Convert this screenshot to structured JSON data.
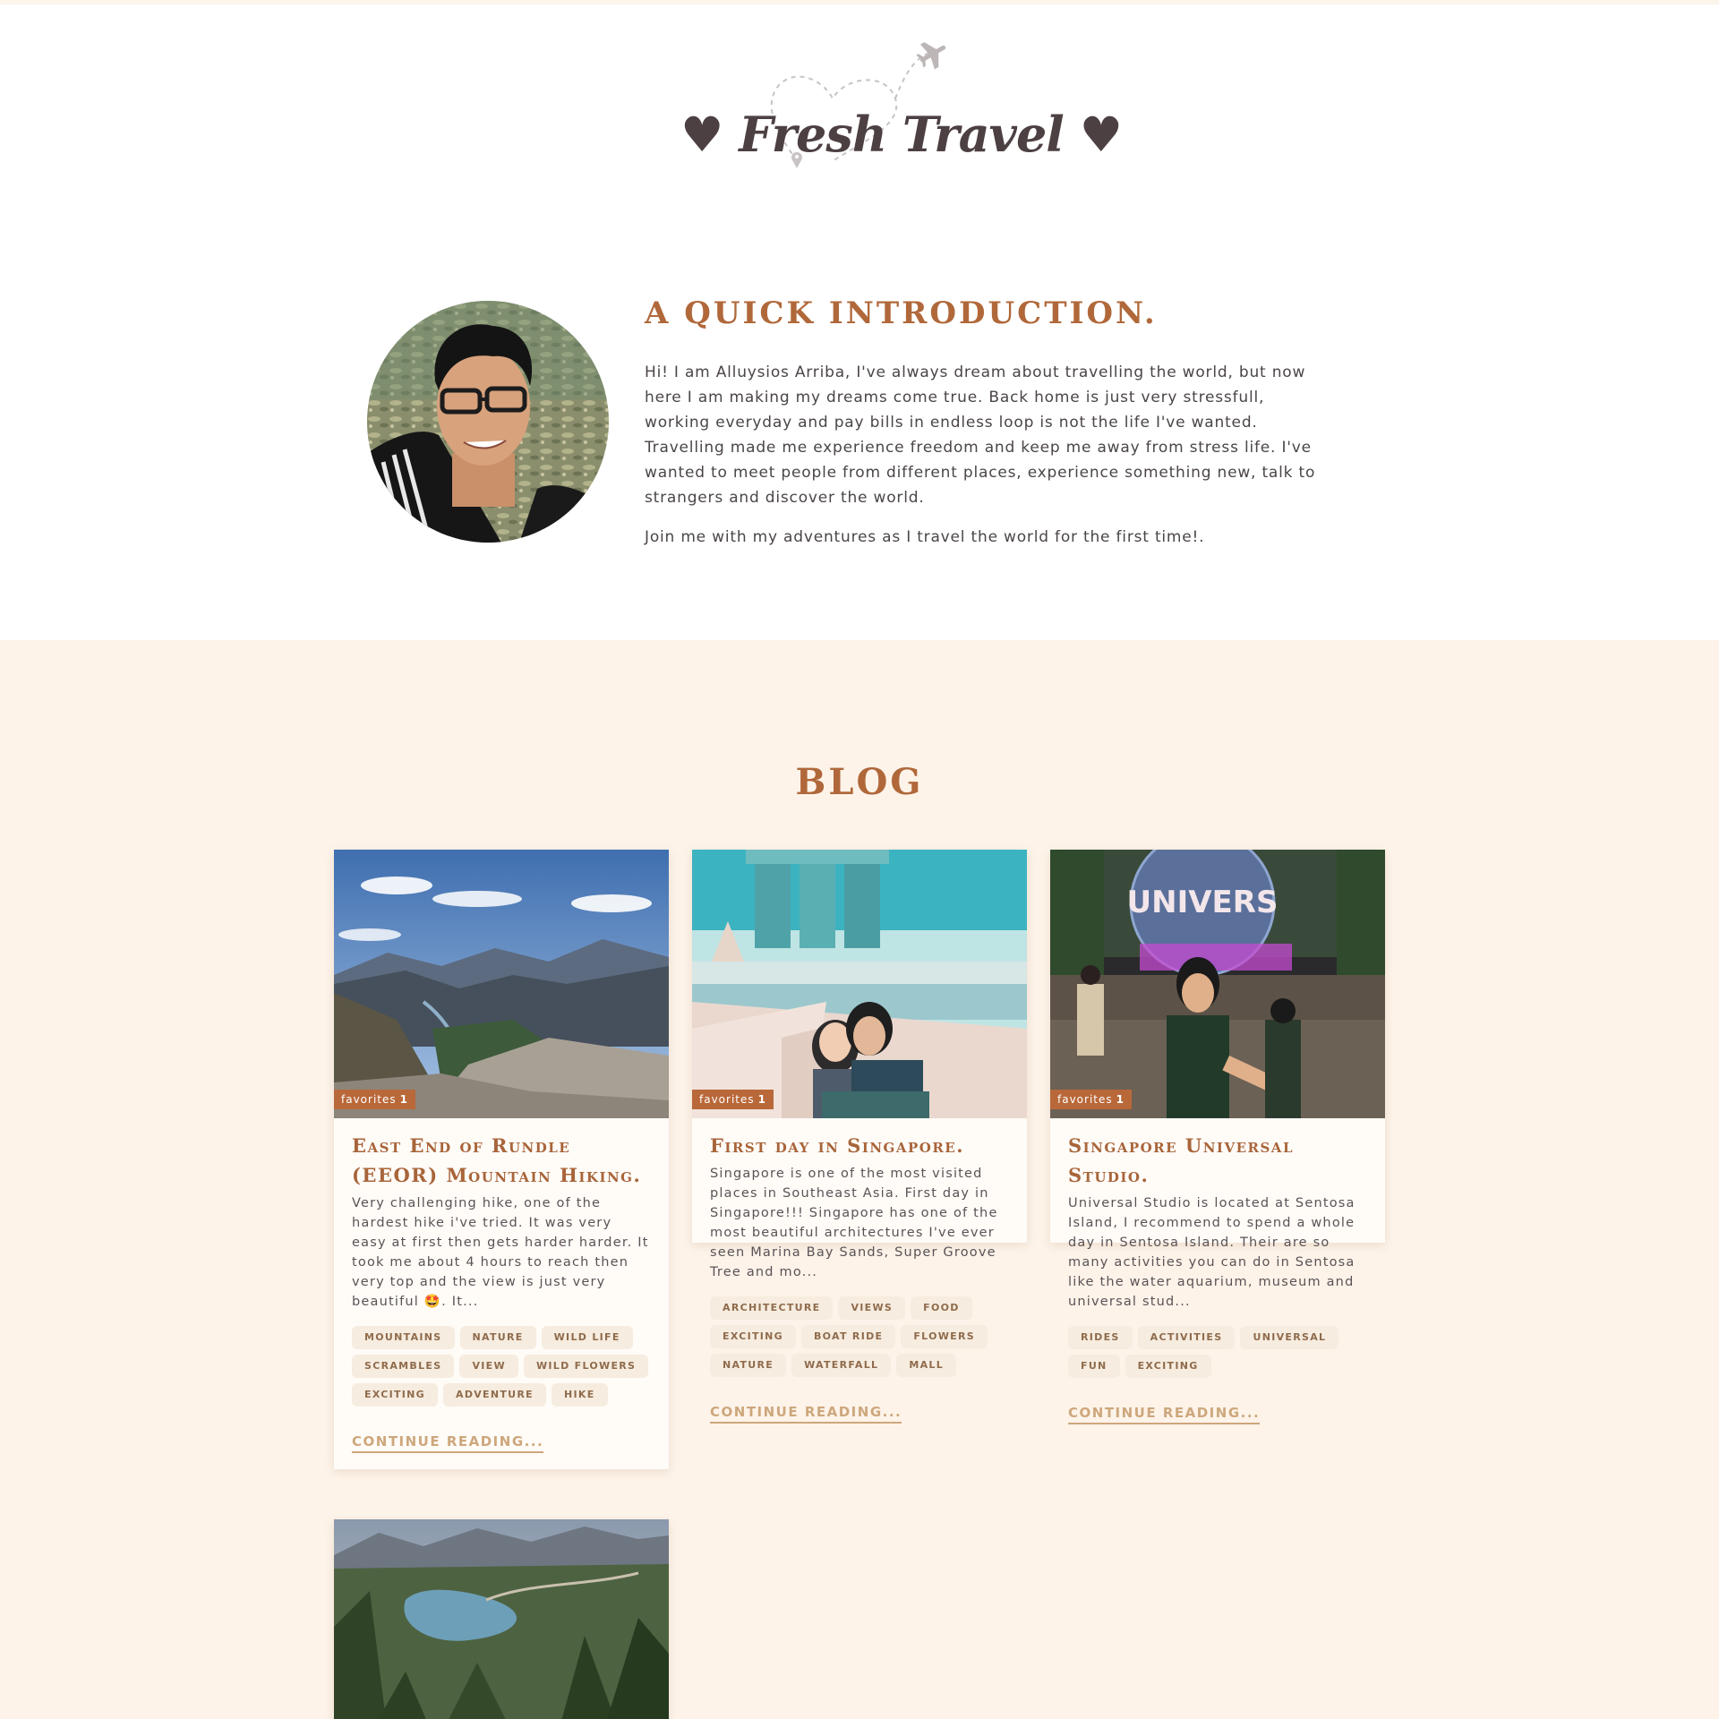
{
  "site": {
    "logo_text": "♥ Fresh Travel ♥"
  },
  "intro": {
    "title": "A QUICK INTRODUCTION.",
    "paragraphs": [
      "Hi! I am Alluysios Arriba, I've always dream about travelling the world, but now here I am making my dreams come true. Back home is just very stressfull, working everyday and pay bills in endless loop is not the life I've wanted. Travelling made me experience freedom and keep me away from stress life. I've wanted to meet people from different places, experience something new, talk to strangers and discover the world.",
      "Join me with my adventures as I travel the world for the first time!."
    ]
  },
  "blog": {
    "heading": "BLOG",
    "posts": [
      {
        "badge_label": "favorites",
        "badge_count": "1",
        "title": "East End of Rundle (EEOR) Mountain Hiking.",
        "excerpt": "Very challenging hike, one of the hardest hike i've tried. It was very easy at first then gets harder harder. It took me about 4 hours to reach then very top and the view is just very beautiful 🤩. It...",
        "tags": [
          "Mountains",
          "Nature",
          "Wild Life",
          "Scrambles",
          "View",
          "Wild Flowers",
          "Exciting",
          "Adventure",
          "Hike"
        ],
        "continue_label": "Continue reading..."
      },
      {
        "badge_label": "favorites",
        "badge_count": "1",
        "title": "First day in Singapore.",
        "excerpt": "Singapore is one of the most visited places in Southeast Asia. First day in Singapore!!! Singapore has one of the most beautiful architectures I've ever seen Marina Bay Sands, Super Groove Tree and mo...",
        "tags": [
          "Architecture",
          "Views",
          "Food",
          "Exciting",
          "Boat Ride",
          "Flowers",
          "Nature",
          "Waterfall",
          "Mall"
        ],
        "continue_label": "Continue reading..."
      },
      {
        "badge_label": "favorites",
        "badge_count": "1",
        "title": "Singapore Universal Studio.",
        "excerpt": "Universal Studio is located at Sentosa Island, I recommend to spend a whole day in Sentosa Island. Their are so many activities you can do in Sentosa like the water aquarium, museum and universal stud...",
        "tags": [
          "Rides",
          "Activities",
          "Universal",
          "Fun",
          "Exciting"
        ],
        "continue_label": "Continue reading...",
        "image_sign": "UNIVERS"
      }
    ]
  },
  "colors": {
    "accent": "#b0683a",
    "section_bg": "#fdf3e9",
    "tag_bg": "#f6ecdf",
    "link": "#cda77c"
  }
}
